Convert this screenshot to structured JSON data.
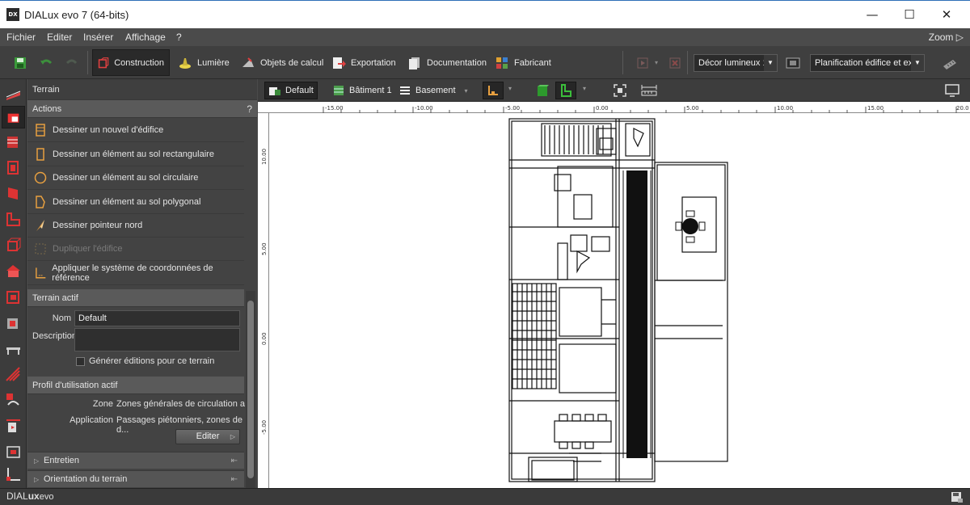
{
  "window": {
    "title": "DIALux evo 7  (64-bits)",
    "logo": "DX"
  },
  "window_buttons": {
    "minimize": "—",
    "maximize": "☐",
    "close": "✕"
  },
  "menu": {
    "items": [
      "Fichier",
      "Editer",
      "Insérer",
      "Affichage",
      "?"
    ],
    "zoom": "Zoom ▷"
  },
  "toolbar": {
    "tabs": [
      {
        "label": "Construction",
        "icon": "construction-icon"
      },
      {
        "label": "Lumière",
        "icon": "light-icon"
      },
      {
        "label": "Objets de calcul",
        "icon": "calc-objects-icon"
      },
      {
        "label": "Exportation",
        "icon": "export-icon"
      },
      {
        "label": "Documentation",
        "icon": "documentation-icon"
      },
      {
        "label": "Fabricant",
        "icon": "manufacturer-icon"
      }
    ],
    "scene_dropdown": "Décor lumineux 1",
    "planning_dropdown": "Planification édifice et ex..."
  },
  "panel": {
    "title": "Terrain",
    "actions_header": "Actions",
    "help": "?",
    "actions": [
      {
        "label": "Dessiner un nouvel d'édifice",
        "enabled": true
      },
      {
        "label": "Dessiner un élément au sol rectangulaire",
        "enabled": true
      },
      {
        "label": "Dessiner un élément au sol circulaire",
        "enabled": true
      },
      {
        "label": "Dessiner un élément au sol polygonal",
        "enabled": true
      },
      {
        "label": "Dessiner pointeur nord",
        "enabled": true
      },
      {
        "label": "Dupliquer l'édifice",
        "enabled": false
      },
      {
        "label": "Appliquer le système de coordonnées de référence",
        "enabled": true
      }
    ],
    "active_terrain": {
      "header": "Terrain actif",
      "name_label": "Nom",
      "name_value": "Default",
      "description_label": "Description",
      "description_value": "",
      "checkbox_label": "Générer éditions pour ce terrain"
    },
    "usage_profile": {
      "header": "Profil d'utilisation actif",
      "zone_label": "Zone",
      "zone_value": "Zones générales de circulation a...",
      "application_label": "Application",
      "application_value": "Passages piétonniers, zones de d...",
      "edit_button": "Editer"
    },
    "collapsed_sections": [
      "Entretien",
      "Orientation du terrain"
    ]
  },
  "viewbar": {
    "items": [
      "Default",
      "Bâtiment 1",
      "Basement"
    ]
  },
  "rulers": {
    "top": [
      "-15.00",
      "-10.00",
      "-5.00",
      "0.00",
      "5.00",
      "10.00",
      "15.00",
      "20.0"
    ],
    "left": [
      "10.00",
      "5.00",
      "0.00",
      "-5.00"
    ]
  },
  "statusbar": {
    "brand_a": "DIAL",
    "brand_b": "ux",
    "brand_c": "evo"
  }
}
